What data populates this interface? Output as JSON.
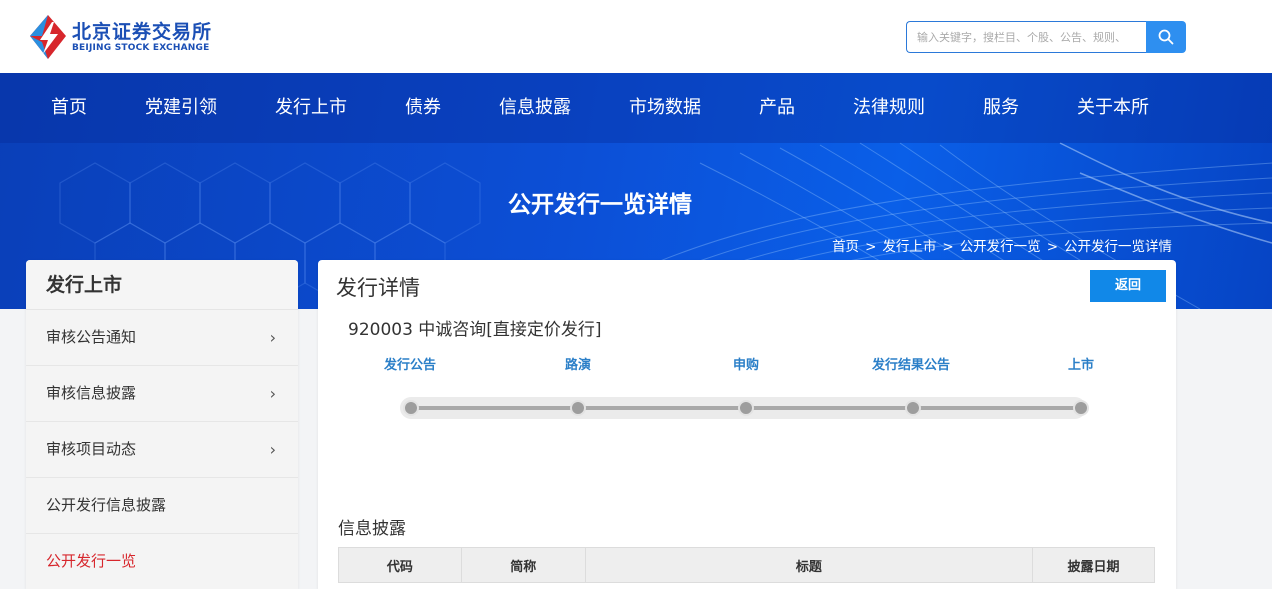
{
  "header": {
    "logo_cn": "北京证券交易所",
    "logo_en": "BEIJING STOCK EXCHANGE",
    "search_placeholder": "输入关键字，搜栏目、个股、公告、规则、"
  },
  "nav": {
    "items": [
      "首页",
      "党建引领",
      "发行上市",
      "债券",
      "信息披露",
      "市场数据",
      "产品",
      "法律规则",
      "服务",
      "关于本所"
    ]
  },
  "banner": {
    "title": "公开发行一览详情",
    "breadcrumb": [
      "首页",
      "发行上市",
      "公开发行一览",
      "公开发行一览详情"
    ],
    "breadcrumb_sep": ">"
  },
  "sidebar": {
    "title": "发行上市",
    "items": [
      {
        "label": "审核公告通知",
        "chevron": "›"
      },
      {
        "label": "审核信息披露",
        "chevron": "›"
      },
      {
        "label": "审核项目动态",
        "chevron": "›"
      },
      {
        "label": "公开发行信息披露"
      },
      {
        "label": "公开发行一览",
        "active": true
      }
    ]
  },
  "main": {
    "title": "发行详情",
    "back_label": "返回",
    "stock": "920003 中诚咨询[直接定价发行]",
    "steps": [
      "发行公告",
      "路演",
      "申购",
      "发行结果公告",
      "上市"
    ],
    "disclosure_title": "信息披露",
    "table_headers": [
      "代码",
      "简称",
      "标题",
      "披露日期"
    ]
  },
  "colors": {
    "brand_blue": "#1b4fb5",
    "button_blue": "#1188e8",
    "step_label": "#2b7fc8",
    "active_red": "#d7262c"
  }
}
